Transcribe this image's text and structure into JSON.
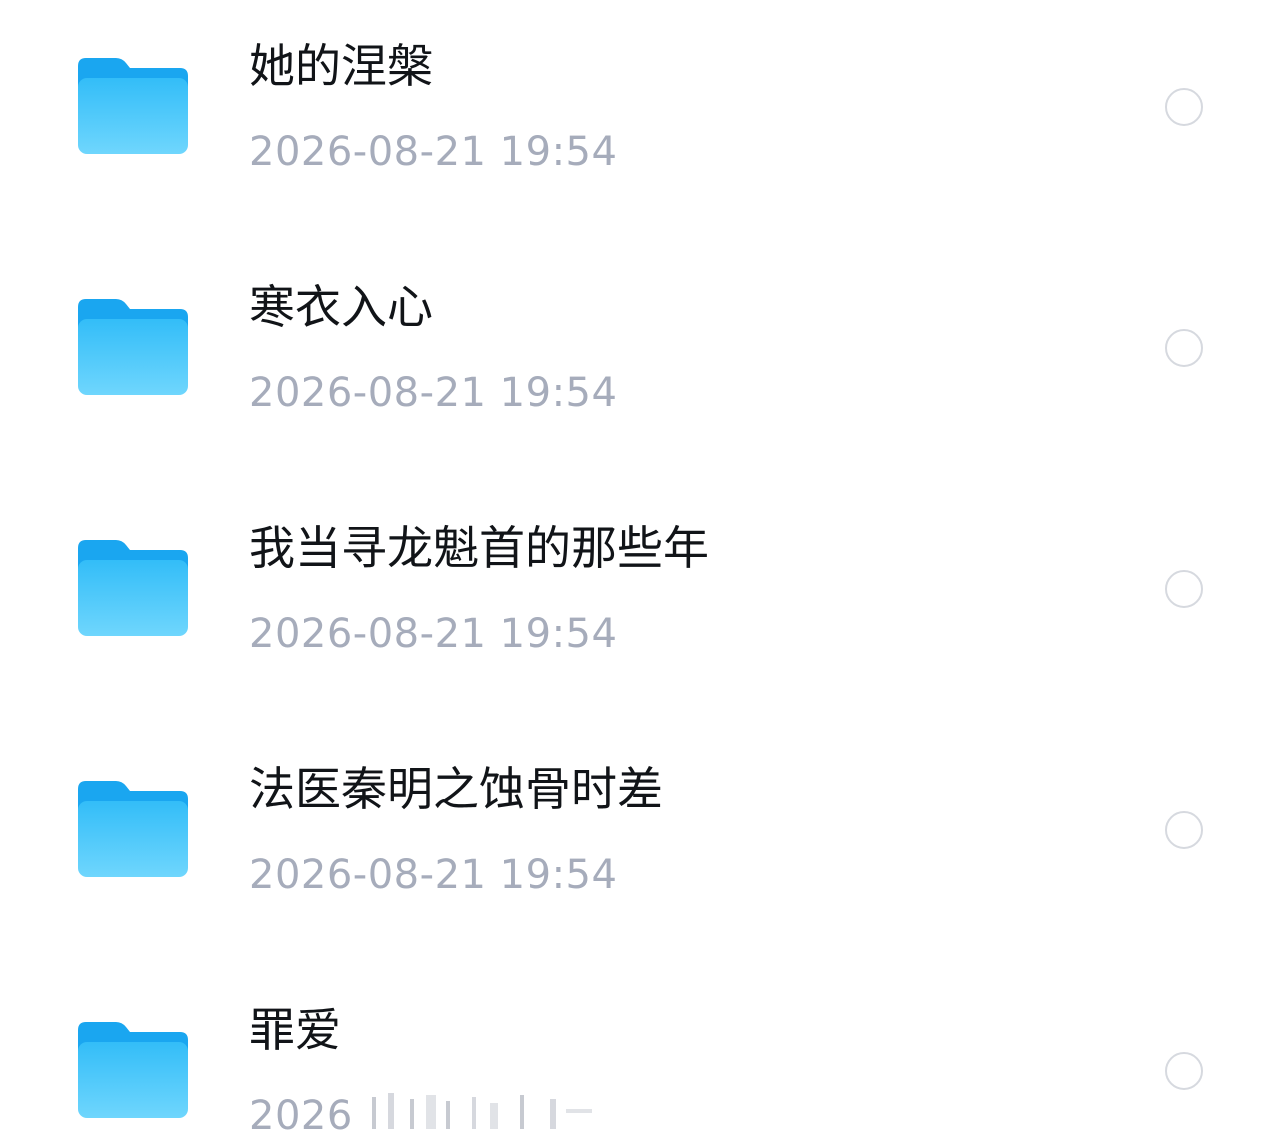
{
  "folders": [
    {
      "name": "她的涅槃",
      "time": "2026-08-21 19:54",
      "selected": false,
      "icon": "folder-icon"
    },
    {
      "name": "寒衣入心",
      "time": "2026-08-21 19:54",
      "selected": false,
      "icon": "folder-icon"
    },
    {
      "name": "我当寻龙魁首的那些年",
      "time": "2026-08-21 19:54",
      "selected": false,
      "icon": "folder-icon"
    },
    {
      "name": "法医秦明之蚀骨时差",
      "time": "2026-08-21 19:54",
      "selected": false,
      "icon": "folder-icon"
    },
    {
      "name": "罪爱",
      "time": "2026",
      "selected": false,
      "icon": "folder-icon"
    }
  ],
  "colors": {
    "folder_back": "#1aa6f0",
    "folder_front_top": "#33bdf8",
    "folder_front_bottom": "#6fd6fd",
    "name": "#111418",
    "time": "#a6acbb",
    "radio_border": "#d6d9df"
  }
}
